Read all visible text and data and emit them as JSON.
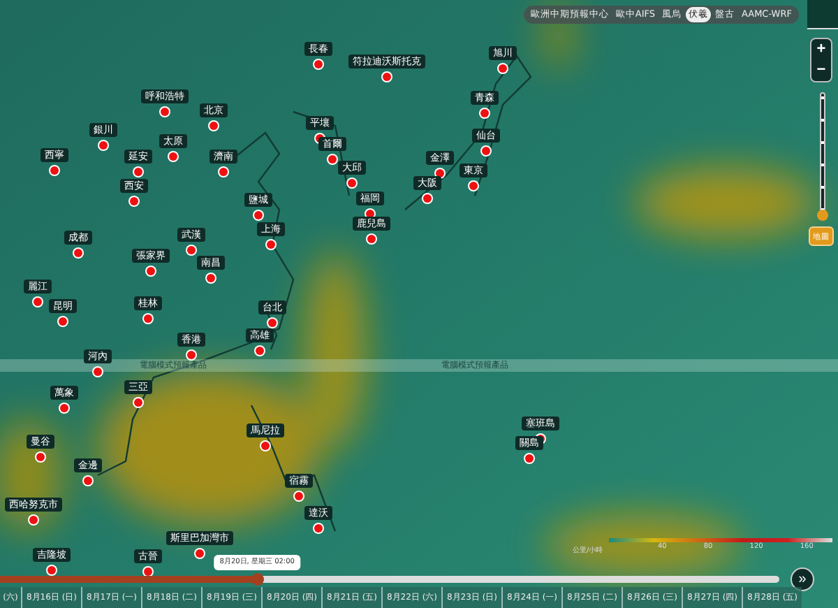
{
  "model_tabs": [
    {
      "label": "歐洲中期預報中心",
      "selected": false
    },
    {
      "label": "歐中AIFS",
      "selected": false
    },
    {
      "label": "風烏",
      "selected": false
    },
    {
      "label": "伏羲",
      "selected": true
    },
    {
      "label": "盤古",
      "selected": false
    },
    {
      "label": "AAMC-WRF",
      "selected": false
    }
  ],
  "zoom": {
    "in": "+",
    "out": "−",
    "level": 0
  },
  "map_button": "地圖",
  "banner": [
    "電腦模式預報產品",
    "電腦模式預報產品"
  ],
  "cities": [
    "長春",
    "符拉迪沃斯托克",
    "呼和浩特",
    "北京",
    "銀川",
    "太原",
    "西寧",
    "延安",
    "濟南",
    "西安",
    "平壤",
    "首爾",
    "大邱",
    "鹽城",
    "福岡",
    "上海",
    "鹿兒島",
    "成都",
    "武漢",
    "張家界",
    "南昌",
    "麗江",
    "昆明",
    "桂林",
    "台北",
    "香港",
    "高雄",
    "河內",
    "三亞",
    "萬象",
    "馬尼拉",
    "曼谷",
    "金邊",
    "宿霧",
    "西哈努克市",
    "達沃",
    "斯里巴加灣市",
    "吉隆坡",
    "古晉",
    "旭川",
    "青森",
    "仙台",
    "金澤",
    "東京",
    "大阪",
    "塞班島",
    "關島"
  ],
  "legend": {
    "unit": "公里/小時",
    "ticks": [
      "40",
      "80",
      "120",
      "160"
    ]
  },
  "timeline": {
    "level": 0.33,
    "tooltip": "8月20日, 星期三 02:00",
    "dates": [
      "(六)",
      "8月16日 (日)",
      "8月17日 (一)",
      "8月18日 (二)",
      "8月19日 (三)",
      "8月20日 (四)",
      "8月21日 (五)",
      "8月22日 (六)",
      "8月23日 (日)",
      "8月24日 (一)",
      "8月25日 (二)",
      "8月26日 (三)",
      "8月27日 (四)",
      "8月28日 (五)"
    ],
    "forward": "»"
  }
}
